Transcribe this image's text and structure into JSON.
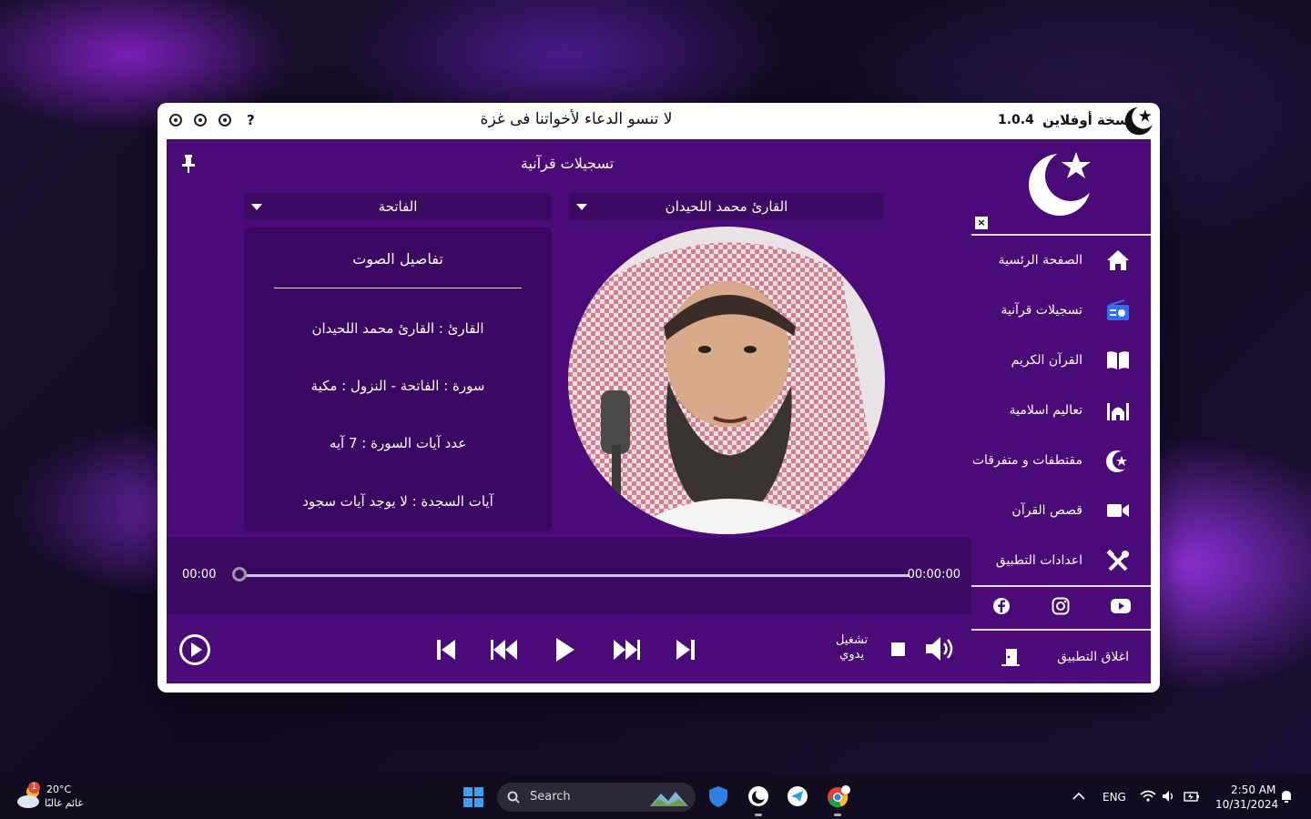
{
  "titlebar": {
    "help": "?",
    "marquee": "لا تنسو الدعاء لأخواتنا فى غزة",
    "version": "1.0.4",
    "offline_label": "نسخة أوفلاين"
  },
  "main": {
    "section_title": "تسجيلات قرآنية",
    "reciter_select": "القارئ محمد اللحيدان",
    "surah_select": "الفاتحة",
    "details": {
      "title": "تفاصيل الصوت",
      "reciter_line": "القارئ : القارئ محمد اللحيدان",
      "surah_line": "سورة  :  الفاتحة  -  النزول  :  مكية",
      "ayat_line": "عدد آيات السورة :  7  آيه",
      "sajda_line": "آيات السجدة  :  لا يوجد آيات سجود"
    },
    "player": {
      "elapsed": "00:00",
      "duration": "00:00:00",
      "progress": 0,
      "mode_line1": "تشغيل",
      "mode_line2": "يدوي"
    }
  },
  "sidebar": {
    "close_badge": "×",
    "items": [
      {
        "label": "الصفحة الرئسية",
        "icon": "home-icon"
      },
      {
        "label": "تسجيلات قرآنية",
        "icon": "radio-icon"
      },
      {
        "label": "القرآن الكريم",
        "icon": "book-icon"
      },
      {
        "label": "تعاليم اسلامية",
        "icon": "mosque-icon"
      },
      {
        "label": "مقتطفات و متفرقات",
        "icon": "crescent-star-icon"
      },
      {
        "label": "قصص القرآن",
        "icon": "video-icon"
      },
      {
        "label": "اعدادات التطبيق",
        "icon": "tools-icon"
      }
    ],
    "close_app": "اغلاق التطبيق"
  },
  "taskbar": {
    "weather_badge": "1",
    "weather_temp": "20°C",
    "weather_cond": "غائم غالبًا",
    "search": "Search",
    "lang": "ENG",
    "time": "2:50 AM",
    "date": "10/31/2024"
  },
  "colors": {
    "primary": "#4a0a78",
    "dark_panel": "#3a0862",
    "accent_blue": "#2f6df6"
  }
}
